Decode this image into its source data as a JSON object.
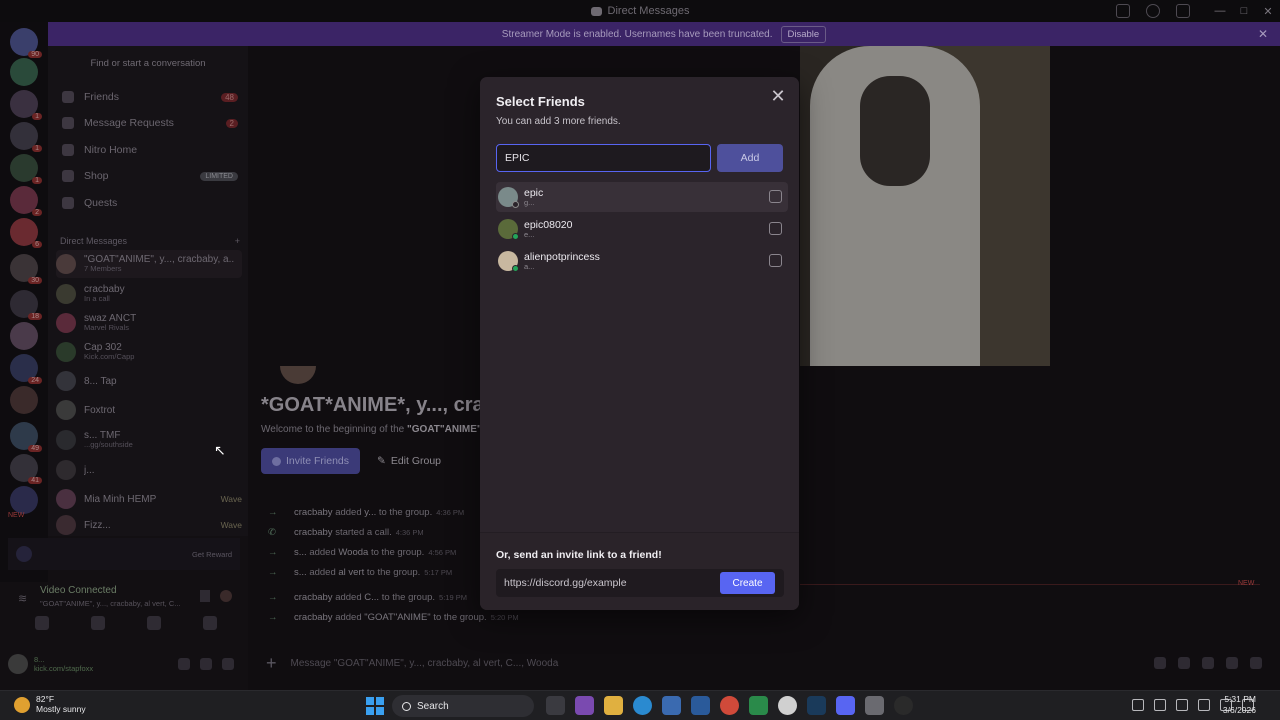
{
  "titlebar": {
    "title": "Direct Messages"
  },
  "streamer_banner": {
    "text": "Streamer Mode is enabled. Usernames have been truncated.",
    "disable_label": "Disable"
  },
  "server_badges": [
    "90",
    "1",
    "1",
    "1",
    "2",
    "6",
    "30",
    "18",
    "24",
    "49",
    "41",
    "NEW"
  ],
  "sidebar": {
    "find_placeholder": "Find or start a conversation",
    "nav": [
      {
        "label": "Friends",
        "count": "48"
      },
      {
        "label": "Message Requests",
        "count": "2"
      },
      {
        "label": "Nitro Home"
      },
      {
        "label": "Shop",
        "tag": "LIMITED"
      },
      {
        "label": "Quests"
      }
    ],
    "dm_header": "Direct Messages",
    "dm_add": "+",
    "dms": [
      {
        "name": "\"GOAT\"ANIME\", y..., cracbaby, a...",
        "status": "7 Members"
      },
      {
        "name": "cracbaby",
        "status": "In a call"
      },
      {
        "name": "swaz  ANCT",
        "status": "Marvel Rivals"
      },
      {
        "name": "Cap  302",
        "status": "Kick.com/Capp"
      },
      {
        "name": "8...  Tap",
        "status": ""
      },
      {
        "name": "Foxtrot",
        "status": ""
      },
      {
        "name": "s...  TMF",
        "status": "...gg/southside"
      },
      {
        "name": "j...",
        "status": ""
      },
      {
        "name": "Mia Minh  HEMP",
        "status": "",
        "extra": "Wave"
      },
      {
        "name": "Fizz...",
        "status": "",
        "extra": "Wave"
      }
    ],
    "promo": {
      "text": "Get Reward"
    },
    "voice": {
      "title": "Video Connected",
      "subtitle": "\"GOAT\"ANIME\", y..., cracbaby, al vert, C..."
    },
    "user": {
      "name": "8...",
      "status": "kick.com/stapfoxx"
    }
  },
  "channel": {
    "title": "*GOAT*ANIME*, y..., cra",
    "welcome_prefix": "Welcome to the beginning of the",
    "welcome_name": "\"GOAT\"ANIME\"",
    "invite_label": "Invite Friends",
    "edit_label": "Edit Group",
    "events": [
      {
        "who": "cracbaby",
        "action": "added",
        "target": "y...",
        "rest": "to the group.",
        "time": "4:36 PM"
      },
      {
        "who": "cracbaby",
        "action": "started a call.",
        "target": "",
        "rest": "",
        "time": "4:36 PM"
      },
      {
        "who": "s...",
        "action": "added",
        "target": "Wooda",
        "rest": "to the group.",
        "time": "4:56 PM"
      },
      {
        "who": "s...",
        "action": "added",
        "target": "al vert",
        "rest": "to the group.",
        "time": "5:17 PM"
      },
      {
        "who": "cracbaby",
        "action": "added",
        "target": "C...",
        "rest": "to the group.",
        "time": "5:19 PM"
      },
      {
        "who": "cracbaby",
        "action": "added",
        "target": "\"GOAT\"ANIME\"",
        "rest": "to the group.",
        "time": "5:20 PM"
      }
    ],
    "new_tag": "NEW",
    "message_placeholder": "Message \"GOAT\"ANIME\", y..., cracbaby, al vert, C..., Wooda"
  },
  "modal": {
    "title": "Select Friends",
    "subtitle": "You can add 3 more friends.",
    "search_value": "EPIC",
    "add_label": "Add",
    "friends": [
      {
        "name": "epic",
        "username": "g...",
        "online": false
      },
      {
        "name": "epic08020",
        "username": "e...",
        "online": true
      },
      {
        "name": "alienpotprincess",
        "username": "a...",
        "online": true
      }
    ],
    "footer_label": "Or, send an invite link to a friend!",
    "invite_link": "https://discord.gg/example",
    "create_label": "Create",
    "close_icon": "close-icon"
  },
  "taskbar": {
    "weather_temp": "82°F",
    "weather_desc": "Mostly sunny",
    "search_label": "Search",
    "time": "5:31 PM",
    "date": "3/6/2026"
  },
  "colors": {
    "accent": "#5865f2",
    "online": "#23a55a",
    "banner": "#3b2466"
  }
}
